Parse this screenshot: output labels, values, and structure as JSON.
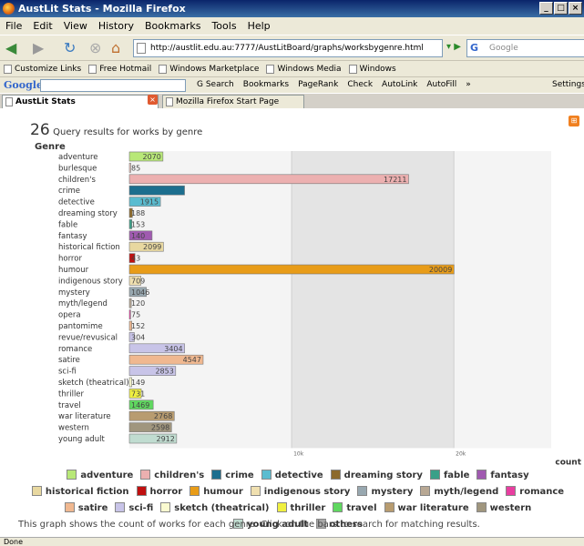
{
  "window": {
    "title": "AustLit Stats - Mozilla Firefox",
    "buttons": [
      "_",
      "□",
      "×"
    ]
  },
  "menu": [
    "File",
    "Edit",
    "View",
    "History",
    "Bookmarks",
    "Tools",
    "Help"
  ],
  "nav": {
    "url": "http://austlit.edu.au:7777/AustLitBoard/graphs/worksbygenre.html",
    "search_placeholder": "Google"
  },
  "bookmarks": [
    "Customize Links",
    "Free Hotmail",
    "Windows Marketplace",
    "Windows Media",
    "Windows"
  ],
  "googlebar": {
    "logo": "Google",
    "items": [
      "G Search",
      "Bookmarks",
      "PageRank",
      "Check",
      "AutoLink",
      "AutoFill",
      "»"
    ],
    "settings": "Settings"
  },
  "tabs": [
    {
      "label": "AustLit Stats",
      "active": true
    },
    {
      "label": "Mozilla Firefox Start Page",
      "active": false
    }
  ],
  "page": {
    "result_count": "26",
    "result_label": "Query results for works by genre",
    "genre_heading": "Genre",
    "caption": "This graph shows the count of works for each genre. Click on the bars to search for matching results."
  },
  "chart_data": {
    "type": "bar",
    "orientation": "horizontal",
    "ylabel": "Genre",
    "xlabel": "count",
    "xlim": [
      0,
      26000
    ],
    "xticks": [
      10000,
      20000
    ],
    "xtick_labels": [
      "10k",
      "20k"
    ],
    "grid": true,
    "legend_position": "bottom",
    "categories": [
      "adventure",
      "burlesque",
      "children's",
      "crime",
      "detective",
      "dreaming story",
      "fable",
      "fantasy",
      "historical fiction",
      "horror",
      "humour",
      "indigenous story",
      "mystery",
      "myth/legend",
      "opera",
      "pantomime",
      "revue/revusical",
      "romance",
      "satire",
      "sci-fi",
      "sketch (theatrical)",
      "thriller",
      "travel",
      "war literature",
      "western",
      "young adult"
    ],
    "values": [
      2070,
      85,
      17211,
      3400,
      1915,
      188,
      153,
      1400,
      2099,
      343,
      20009,
      709,
      1046,
      120,
      75,
      152,
      304,
      3404,
      4547,
      2853,
      149,
      731,
      1469,
      2768,
      2598,
      2912
    ],
    "value_labels": [
      "2070",
      "85",
      "17211",
      "",
      "1915",
      "188",
      "153",
      "140",
      "2099",
      "43",
      "20009",
      "709",
      "1046",
      "120",
      "75",
      "152",
      "304",
      "3404",
      "4547",
      "2853",
      "149",
      "731",
      "1469",
      "2768",
      "2598",
      "2912"
    ],
    "colors": [
      "#b8e878",
      "#f0c8c0",
      "#ecb0b0",
      "#1c6e8e",
      "#5abcd0",
      "#8c6a2c",
      "#3aa088",
      "#a05ab0",
      "#e8d8a0",
      "#c01010",
      "#e89c18",
      "#f0e0b0",
      "#98a8b0",
      "#b8a894",
      "#e83ea0",
      "#f0b890",
      "#c8c4e8",
      "#c8c4e8",
      "#f0b890",
      "#c8c4e8",
      "#fafad0",
      "#f0f040",
      "#60d860",
      "#b89c70",
      "#a0967e",
      "#c0dcd0"
    ]
  },
  "legend": [
    {
      "label": "adventure",
      "color": "#b8e878"
    },
    {
      "label": "children's",
      "color": "#ecb0b0"
    },
    {
      "label": "crime",
      "color": "#1c6e8e"
    },
    {
      "label": "detective",
      "color": "#5abcd0"
    },
    {
      "label": "dreaming story",
      "color": "#8c6a2c"
    },
    {
      "label": "fable",
      "color": "#3aa088"
    },
    {
      "label": "fantasy",
      "color": "#a05ab0"
    },
    {
      "label": "historical fiction",
      "color": "#e8d8a0"
    },
    {
      "label": "horror",
      "color": "#c01010"
    },
    {
      "label": "humour",
      "color": "#e89c18"
    },
    {
      "label": "indigenous story",
      "color": "#f0e0b0"
    },
    {
      "label": "mystery",
      "color": "#98a8b0"
    },
    {
      "label": "myth/legend",
      "color": "#b8a894"
    },
    {
      "label": "romance",
      "color": "#e83ea0"
    },
    {
      "label": "satire",
      "color": "#f0b890"
    },
    {
      "label": "sci-fi",
      "color": "#c8c4e8"
    },
    {
      "label": "sketch (theatrical)",
      "color": "#fafad0"
    },
    {
      "label": "thriller",
      "color": "#f0f040"
    },
    {
      "label": "travel",
      "color": "#60d860"
    },
    {
      "label": "war literature",
      "color": "#b89c70"
    },
    {
      "label": "western",
      "color": "#a0967e"
    },
    {
      "label": "young adult",
      "color": "#c0dcd0"
    },
    {
      "label": "others",
      "color": "#a8a8a8"
    }
  ],
  "status": "Done"
}
